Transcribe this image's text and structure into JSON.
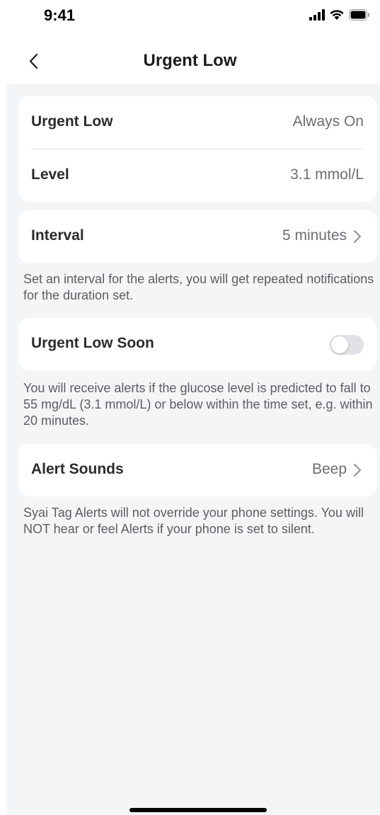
{
  "status_bar": {
    "time": "9:41",
    "icons": [
      "cellular-signal-icon",
      "wifi-icon",
      "battery-icon"
    ]
  },
  "nav": {
    "title": "Urgent Low",
    "back_icon": "chevron-left-icon"
  },
  "urgent_low_card": {
    "urgent_low_label": "Urgent Low",
    "urgent_low_value": "Always On",
    "level_label": "Level",
    "level_value": "3.1 mmol/L"
  },
  "interval_card": {
    "label": "Interval",
    "value": "5 minutes"
  },
  "interval_note": "Set an interval for the alerts, you will get repeated notifications for the duration set.",
  "urgent_low_soon_card": {
    "label": "Urgent Low Soon",
    "toggle_on": false
  },
  "urgent_low_soon_note": "You will receive alerts if the glucose level is predicted to fall to 55 mg/dL (3.1 mmol/L) or below within the time set, e.g. within 20 minutes.",
  "alert_sounds_card": {
    "label": "Alert Sounds",
    "value": "Beep"
  },
  "alert_sounds_note": "Syai Tag Alerts will not override your phone settings. You will NOT hear or feel Alerts if your phone is set to silent.",
  "colors": {
    "background": "#f4f5f7",
    "card": "#ffffff",
    "toggle_off": "#e2e2e6"
  }
}
